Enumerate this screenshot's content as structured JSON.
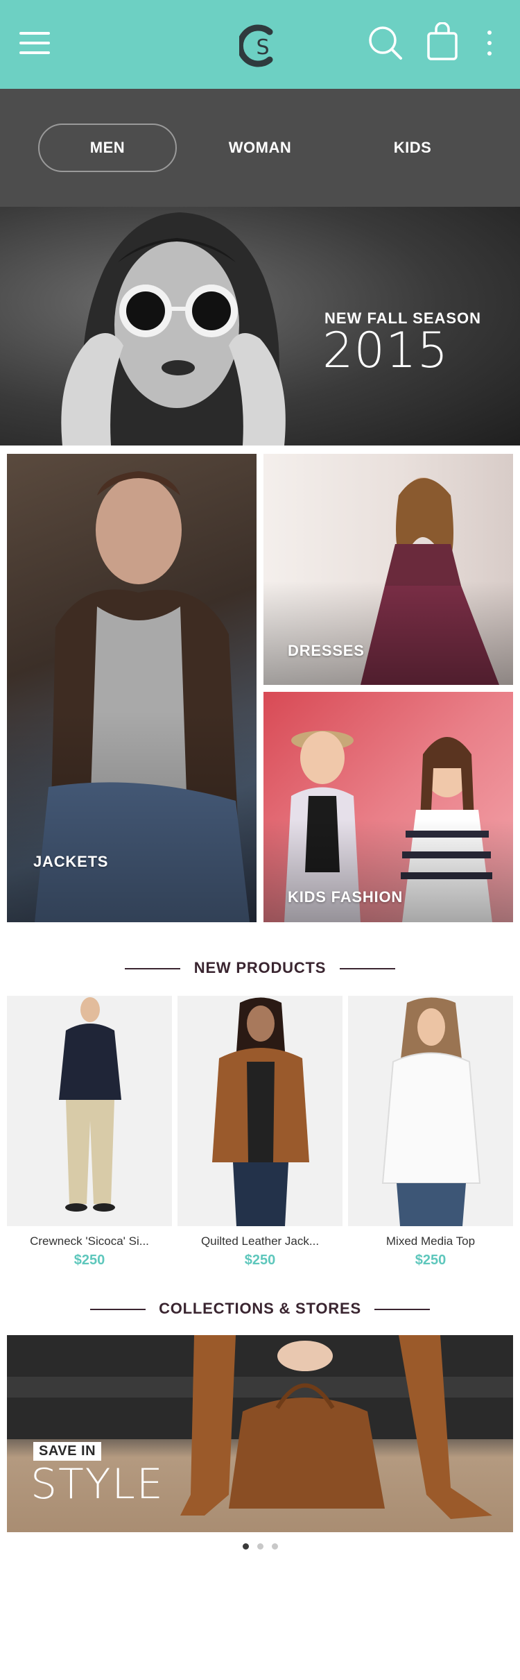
{
  "header": {
    "logo_text": "S",
    "accent_color": "#6dd0c3"
  },
  "tabs": [
    {
      "label": "MEN",
      "active": true
    },
    {
      "label": "WOMAN",
      "active": false
    },
    {
      "label": "KIDS",
      "active": false
    }
  ],
  "hero": {
    "subtitle": "NEW FALL SEASON",
    "year": "2015"
  },
  "categories": [
    {
      "label": "JACKETS"
    },
    {
      "label": "DRESSES"
    },
    {
      "label": "KIDS FASHION"
    }
  ],
  "new_products": {
    "heading": "NEW PRODUCTS",
    "items": [
      {
        "name": "Crewneck 'Sicoca' Si...",
        "price": "$250"
      },
      {
        "name": "Quilted Leather Jack...",
        "price": "$250"
      },
      {
        "name": "Mixed Media Top",
        "price": "$250"
      }
    ]
  },
  "collections": {
    "heading": "COLLECTIONS & STORES",
    "badge": "SAVE IN",
    "title": "STYLE"
  },
  "pager": {
    "count": 3,
    "active_index": 0
  },
  "price_color": "#5ec7bc"
}
